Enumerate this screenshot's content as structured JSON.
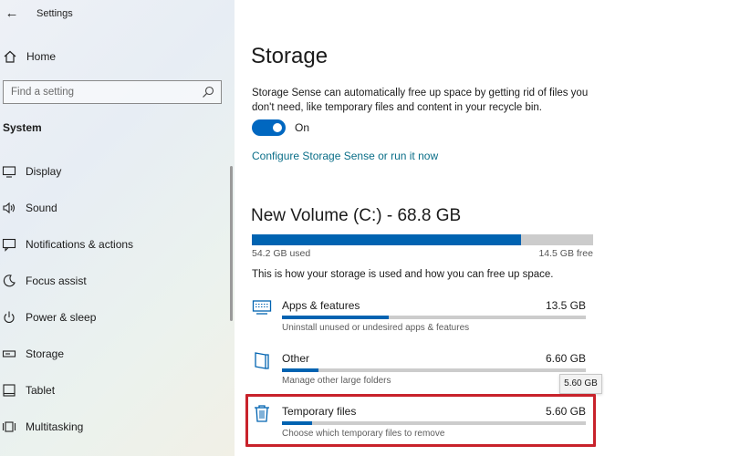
{
  "window": {
    "app_title": "Settings",
    "back_glyph": "←",
    "minimize_glyph": "—",
    "maximize_glyph": "☐",
    "close_glyph": "✕"
  },
  "sidebar": {
    "home_label": "Home",
    "search_placeholder": "Find a setting",
    "section_title": "System",
    "items": [
      {
        "label": "Display",
        "icon": "display-icon"
      },
      {
        "label": "Sound",
        "icon": "sound-icon"
      },
      {
        "label": "Notifications & actions",
        "icon": "notifications-icon"
      },
      {
        "label": "Focus assist",
        "icon": "focus-assist-icon"
      },
      {
        "label": "Power & sleep",
        "icon": "power-icon"
      },
      {
        "label": "Storage",
        "icon": "storage-icon"
      },
      {
        "label": "Tablet",
        "icon": "tablet-icon"
      },
      {
        "label": "Multitasking",
        "icon": "multitasking-icon"
      }
    ]
  },
  "main": {
    "title": "Storage",
    "description": "Storage Sense can automatically free up space by getting rid of files you don't need, like temporary files and content in your recycle bin.",
    "toggle_label": "On",
    "toggle_on": true,
    "config_link": "Configure Storage Sense or run it now",
    "volume": {
      "title": "New Volume (C:) - 68.8 GB",
      "used_label": "54.2 GB used",
      "free_label": "14.5 GB free",
      "used_fraction": 0.788
    },
    "usage_description": "This is how your storage is used and how you can free up space.",
    "categories": [
      {
        "name": "Apps & features",
        "size": "13.5 GB",
        "subtitle": "Uninstall unused or undesired apps & features",
        "icon": "apps-icon",
        "fraction": 0.35
      },
      {
        "name": "Other",
        "size": "6.60 GB",
        "subtitle": "Manage other large folders",
        "icon": "other-folder-icon",
        "fraction": 0.12
      },
      {
        "name": "Temporary files",
        "size": "5.60 GB",
        "subtitle": "Choose which temporary files to remove",
        "icon": "trash-icon",
        "fraction": 0.1
      }
    ],
    "tooltip": "5.60 GB"
  },
  "colors": {
    "accent": "#0063b1",
    "toggle": "#0067c0",
    "link": "#0a6e88",
    "highlight": "#c8222b"
  }
}
